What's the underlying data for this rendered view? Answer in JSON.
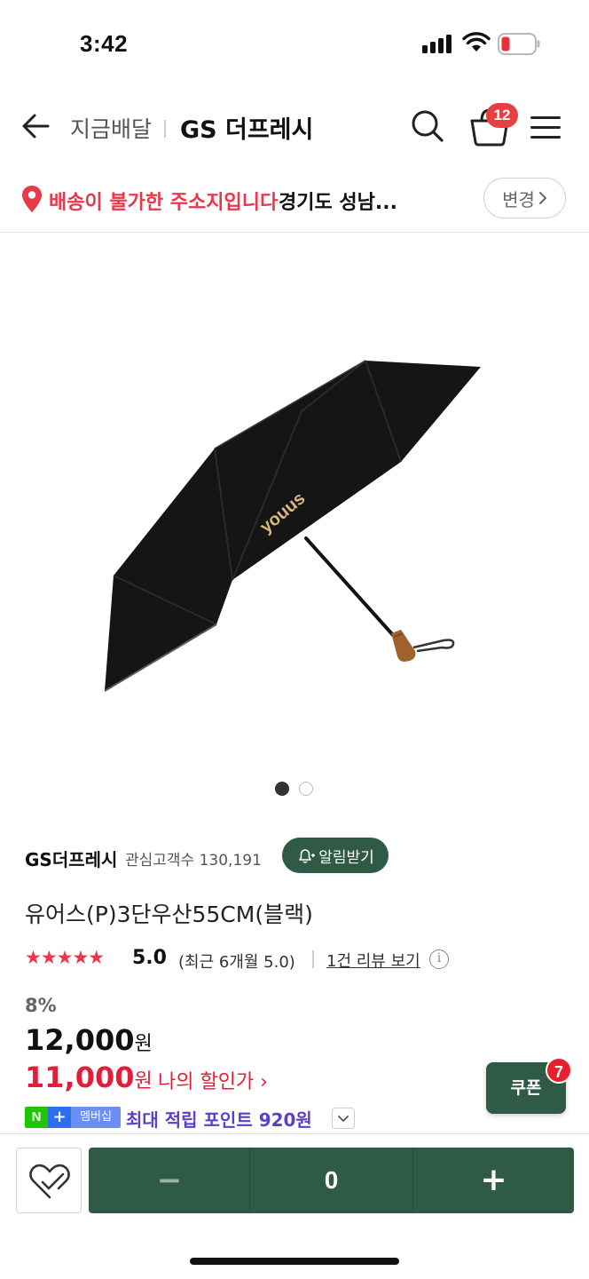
{
  "status_bar": {
    "time": "3:42"
  },
  "nav": {
    "subtitle": "지금배달",
    "title": "GS 더프레시",
    "cart_count": "12"
  },
  "address": {
    "warning": "배송이 불가한 주소지입니다",
    "location": "경기도 성남...",
    "change_label": "변경"
  },
  "carousel": {
    "total": 2,
    "active": 1
  },
  "seller": {
    "name": "GS더프레시",
    "fans": "관심고객수 130,191",
    "alert_label": "알림받기"
  },
  "product": {
    "title": "유어스(P)3단우산55CM(블랙)",
    "image_brand": "youus"
  },
  "rating": {
    "stars": "★★★★★",
    "score": "5.0",
    "recent": "(최근 6개월 5.0)",
    "review_link": "1건 리뷰 보기",
    "info_icon": "i"
  },
  "price": {
    "discount_rate": "8%",
    "original": "12,000",
    "sale": "11,000",
    "currency": "원",
    "sale_label": "나의 할인가 ›"
  },
  "membership": {
    "n": "N",
    "plus": "+",
    "badge": "멤버십",
    "points_text": "최대 적립 포인트 920원"
  },
  "coupon": {
    "label": "쿠폰",
    "count": "7"
  },
  "quantity": {
    "minus": "−",
    "value": "0",
    "plus": "+"
  },
  "colors": {
    "brand_green": "#2f5b46",
    "sale_red": "#e21f3a",
    "warning_red": "#e8394a",
    "points_purple": "#5b3fc9"
  }
}
